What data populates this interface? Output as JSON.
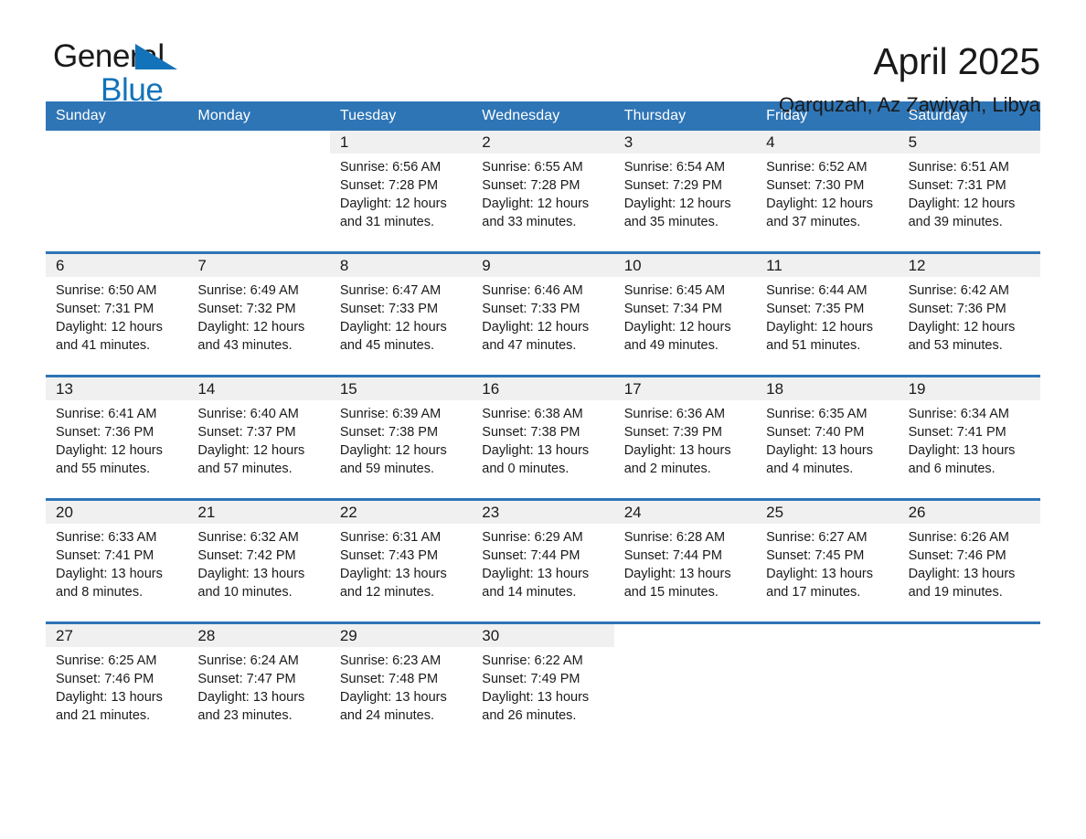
{
  "brand": {
    "name_part1": "General",
    "name_part2": "Blue",
    "accent_color": "#1273ba"
  },
  "header": {
    "title": "April 2025",
    "subtitle": "Qarquzah, Az Zawiyah, Libya"
  },
  "calendar": {
    "header_color": "#2e75b6",
    "day_band_color": "#f0f0f0",
    "weekdays": [
      "Sunday",
      "Monday",
      "Tuesday",
      "Wednesday",
      "Thursday",
      "Friday",
      "Saturday"
    ],
    "weeks": [
      [
        {
          "day": "",
          "empty": true
        },
        {
          "day": "",
          "empty": true
        },
        {
          "day": "1",
          "sunrise": "Sunrise: 6:56 AM",
          "sunset": "Sunset: 7:28 PM",
          "daylight_line1": "Daylight: 12 hours",
          "daylight_line2": "and 31 minutes."
        },
        {
          "day": "2",
          "sunrise": "Sunrise: 6:55 AM",
          "sunset": "Sunset: 7:28 PM",
          "daylight_line1": "Daylight: 12 hours",
          "daylight_line2": "and 33 minutes."
        },
        {
          "day": "3",
          "sunrise": "Sunrise: 6:54 AM",
          "sunset": "Sunset: 7:29 PM",
          "daylight_line1": "Daylight: 12 hours",
          "daylight_line2": "and 35 minutes."
        },
        {
          "day": "4",
          "sunrise": "Sunrise: 6:52 AM",
          "sunset": "Sunset: 7:30 PM",
          "daylight_line1": "Daylight: 12 hours",
          "daylight_line2": "and 37 minutes."
        },
        {
          "day": "5",
          "sunrise": "Sunrise: 6:51 AM",
          "sunset": "Sunset: 7:31 PM",
          "daylight_line1": "Daylight: 12 hours",
          "daylight_line2": "and 39 minutes."
        }
      ],
      [
        {
          "day": "6",
          "sunrise": "Sunrise: 6:50 AM",
          "sunset": "Sunset: 7:31 PM",
          "daylight_line1": "Daylight: 12 hours",
          "daylight_line2": "and 41 minutes."
        },
        {
          "day": "7",
          "sunrise": "Sunrise: 6:49 AM",
          "sunset": "Sunset: 7:32 PM",
          "daylight_line1": "Daylight: 12 hours",
          "daylight_line2": "and 43 minutes."
        },
        {
          "day": "8",
          "sunrise": "Sunrise: 6:47 AM",
          "sunset": "Sunset: 7:33 PM",
          "daylight_line1": "Daylight: 12 hours",
          "daylight_line2": "and 45 minutes."
        },
        {
          "day": "9",
          "sunrise": "Sunrise: 6:46 AM",
          "sunset": "Sunset: 7:33 PM",
          "daylight_line1": "Daylight: 12 hours",
          "daylight_line2": "and 47 minutes."
        },
        {
          "day": "10",
          "sunrise": "Sunrise: 6:45 AM",
          "sunset": "Sunset: 7:34 PM",
          "daylight_line1": "Daylight: 12 hours",
          "daylight_line2": "and 49 minutes."
        },
        {
          "day": "11",
          "sunrise": "Sunrise: 6:44 AM",
          "sunset": "Sunset: 7:35 PM",
          "daylight_line1": "Daylight: 12 hours",
          "daylight_line2": "and 51 minutes."
        },
        {
          "day": "12",
          "sunrise": "Sunrise: 6:42 AM",
          "sunset": "Sunset: 7:36 PM",
          "daylight_line1": "Daylight: 12 hours",
          "daylight_line2": "and 53 minutes."
        }
      ],
      [
        {
          "day": "13",
          "sunrise": "Sunrise: 6:41 AM",
          "sunset": "Sunset: 7:36 PM",
          "daylight_line1": "Daylight: 12 hours",
          "daylight_line2": "and 55 minutes."
        },
        {
          "day": "14",
          "sunrise": "Sunrise: 6:40 AM",
          "sunset": "Sunset: 7:37 PM",
          "daylight_line1": "Daylight: 12 hours",
          "daylight_line2": "and 57 minutes."
        },
        {
          "day": "15",
          "sunrise": "Sunrise: 6:39 AM",
          "sunset": "Sunset: 7:38 PM",
          "daylight_line1": "Daylight: 12 hours",
          "daylight_line2": "and 59 minutes."
        },
        {
          "day": "16",
          "sunrise": "Sunrise: 6:38 AM",
          "sunset": "Sunset: 7:38 PM",
          "daylight_line1": "Daylight: 13 hours",
          "daylight_line2": "and 0 minutes."
        },
        {
          "day": "17",
          "sunrise": "Sunrise: 6:36 AM",
          "sunset": "Sunset: 7:39 PM",
          "daylight_line1": "Daylight: 13 hours",
          "daylight_line2": "and 2 minutes."
        },
        {
          "day": "18",
          "sunrise": "Sunrise: 6:35 AM",
          "sunset": "Sunset: 7:40 PM",
          "daylight_line1": "Daylight: 13 hours",
          "daylight_line2": "and 4 minutes."
        },
        {
          "day": "19",
          "sunrise": "Sunrise: 6:34 AM",
          "sunset": "Sunset: 7:41 PM",
          "daylight_line1": "Daylight: 13 hours",
          "daylight_line2": "and 6 minutes."
        }
      ],
      [
        {
          "day": "20",
          "sunrise": "Sunrise: 6:33 AM",
          "sunset": "Sunset: 7:41 PM",
          "daylight_line1": "Daylight: 13 hours",
          "daylight_line2": "and 8 minutes."
        },
        {
          "day": "21",
          "sunrise": "Sunrise: 6:32 AM",
          "sunset": "Sunset: 7:42 PM",
          "daylight_line1": "Daylight: 13 hours",
          "daylight_line2": "and 10 minutes."
        },
        {
          "day": "22",
          "sunrise": "Sunrise: 6:31 AM",
          "sunset": "Sunset: 7:43 PM",
          "daylight_line1": "Daylight: 13 hours",
          "daylight_line2": "and 12 minutes."
        },
        {
          "day": "23",
          "sunrise": "Sunrise: 6:29 AM",
          "sunset": "Sunset: 7:44 PM",
          "daylight_line1": "Daylight: 13 hours",
          "daylight_line2": "and 14 minutes."
        },
        {
          "day": "24",
          "sunrise": "Sunrise: 6:28 AM",
          "sunset": "Sunset: 7:44 PM",
          "daylight_line1": "Daylight: 13 hours",
          "daylight_line2": "and 15 minutes."
        },
        {
          "day": "25",
          "sunrise": "Sunrise: 6:27 AM",
          "sunset": "Sunset: 7:45 PM",
          "daylight_line1": "Daylight: 13 hours",
          "daylight_line2": "and 17 minutes."
        },
        {
          "day": "26",
          "sunrise": "Sunrise: 6:26 AM",
          "sunset": "Sunset: 7:46 PM",
          "daylight_line1": "Daylight: 13 hours",
          "daylight_line2": "and 19 minutes."
        }
      ],
      [
        {
          "day": "27",
          "sunrise": "Sunrise: 6:25 AM",
          "sunset": "Sunset: 7:46 PM",
          "daylight_line1": "Daylight: 13 hours",
          "daylight_line2": "and 21 minutes."
        },
        {
          "day": "28",
          "sunrise": "Sunrise: 6:24 AM",
          "sunset": "Sunset: 7:47 PM",
          "daylight_line1": "Daylight: 13 hours",
          "daylight_line2": "and 23 minutes."
        },
        {
          "day": "29",
          "sunrise": "Sunrise: 6:23 AM",
          "sunset": "Sunset: 7:48 PM",
          "daylight_line1": "Daylight: 13 hours",
          "daylight_line2": "and 24 minutes."
        },
        {
          "day": "30",
          "sunrise": "Sunrise: 6:22 AM",
          "sunset": "Sunset: 7:49 PM",
          "daylight_line1": "Daylight: 13 hours",
          "daylight_line2": "and 26 minutes."
        },
        {
          "day": "",
          "empty": true
        },
        {
          "day": "",
          "empty": true
        },
        {
          "day": "",
          "empty": true
        }
      ]
    ]
  }
}
